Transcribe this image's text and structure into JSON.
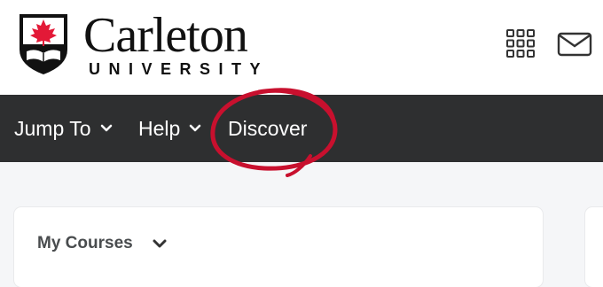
{
  "brand": {
    "name": "Carleton",
    "subtitle": "UNIVERSITY",
    "colors": {
      "shield": "#111111",
      "maple": "#e31937",
      "text": "#111111"
    }
  },
  "header_icons": [
    "waffle-menu-icon",
    "mail-icon"
  ],
  "navbar": {
    "background": "#2e2f30",
    "items": [
      {
        "label": "Jump To",
        "has_dropdown": true
      },
      {
        "label": "Help",
        "has_dropdown": true
      },
      {
        "label": "Discover",
        "has_dropdown": false,
        "highlighted": true
      }
    ],
    "highlight_color": "#c8102e"
  },
  "widget": {
    "title": "My Courses"
  }
}
